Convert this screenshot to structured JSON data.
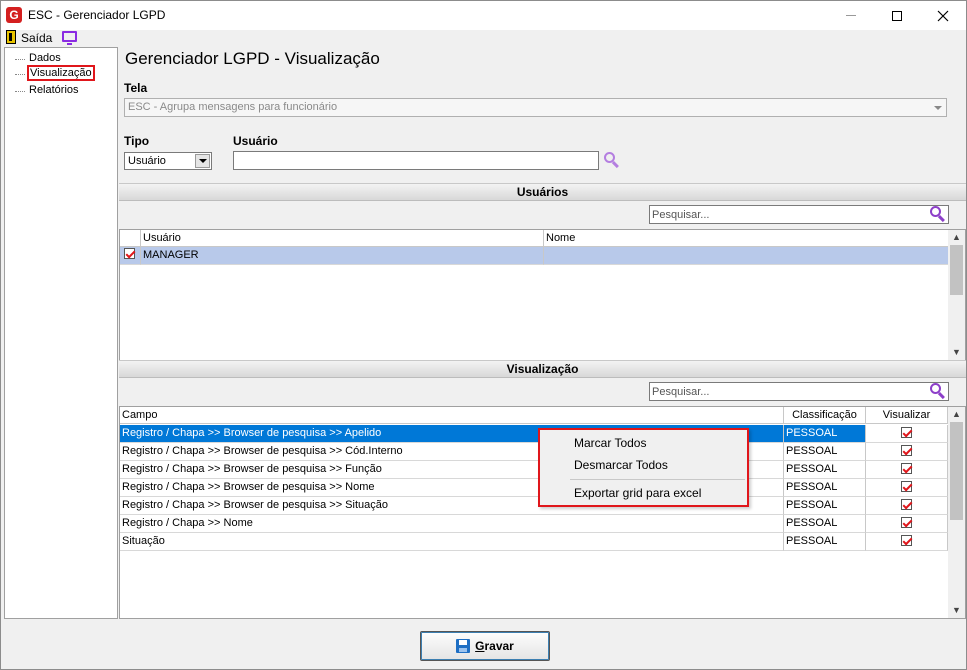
{
  "window": {
    "title": "ESC - Gerenciador LGPD",
    "app_logo": "G"
  },
  "menubar": {
    "exit_label": "Saída"
  },
  "tree": {
    "items": [
      {
        "label": "Dados",
        "selected": false
      },
      {
        "label": "Visualização",
        "selected": true
      },
      {
        "label": "Relatórios",
        "selected": false
      }
    ]
  },
  "main": {
    "title": "Gerenciador LGPD - Visualização",
    "tela_label": "Tela",
    "tela_value": "ESC - Agrupa mensagens para funcionário",
    "tipo_label": "Tipo",
    "tipo_value": "Usuário",
    "usuario_label": "Usuário",
    "usuario_value": ""
  },
  "users_section": {
    "header": "Usuários",
    "search_placeholder": "Pesquisar...",
    "columns": [
      "Usuário",
      "Nome"
    ],
    "rows": [
      {
        "usuario": "MANAGER",
        "nome": "",
        "checked": true
      }
    ]
  },
  "view_section": {
    "header": "Visualização",
    "search_placeholder": "Pesquisar...",
    "columns": [
      "Campo",
      "Classificação",
      "Visualizar"
    ],
    "rows": [
      {
        "campo": "Registro / Chapa >> Browser de pesquisa >> Apelido",
        "classificacao": "PESSOAL",
        "visualizar": true
      },
      {
        "campo": "Registro / Chapa >> Browser de pesquisa >> Cód.Interno",
        "classificacao": "PESSOAL",
        "visualizar": true
      },
      {
        "campo": "Registro / Chapa >> Browser de pesquisa >> Função",
        "classificacao": "PESSOAL",
        "visualizar": true
      },
      {
        "campo": "Registro / Chapa >> Browser de pesquisa >> Nome",
        "classificacao": "PESSOAL",
        "visualizar": true
      },
      {
        "campo": "Registro / Chapa >> Browser de pesquisa >> Situação",
        "classificacao": "PESSOAL",
        "visualizar": true
      },
      {
        "campo": "Registro / Chapa >> Nome",
        "classificacao": "PESSOAL",
        "visualizar": true
      },
      {
        "campo": "Situação",
        "classificacao": "PESSOAL",
        "visualizar": true
      }
    ]
  },
  "context_menu": {
    "items": [
      "Marcar Todos",
      "Desmarcar Todos",
      "Exportar grid para excel"
    ]
  },
  "footer": {
    "save_label": "Gravar"
  },
  "colors": {
    "accent_red": "#e0161b",
    "selection_blue": "#0078d7",
    "search_icon": "#8d3fc9"
  }
}
